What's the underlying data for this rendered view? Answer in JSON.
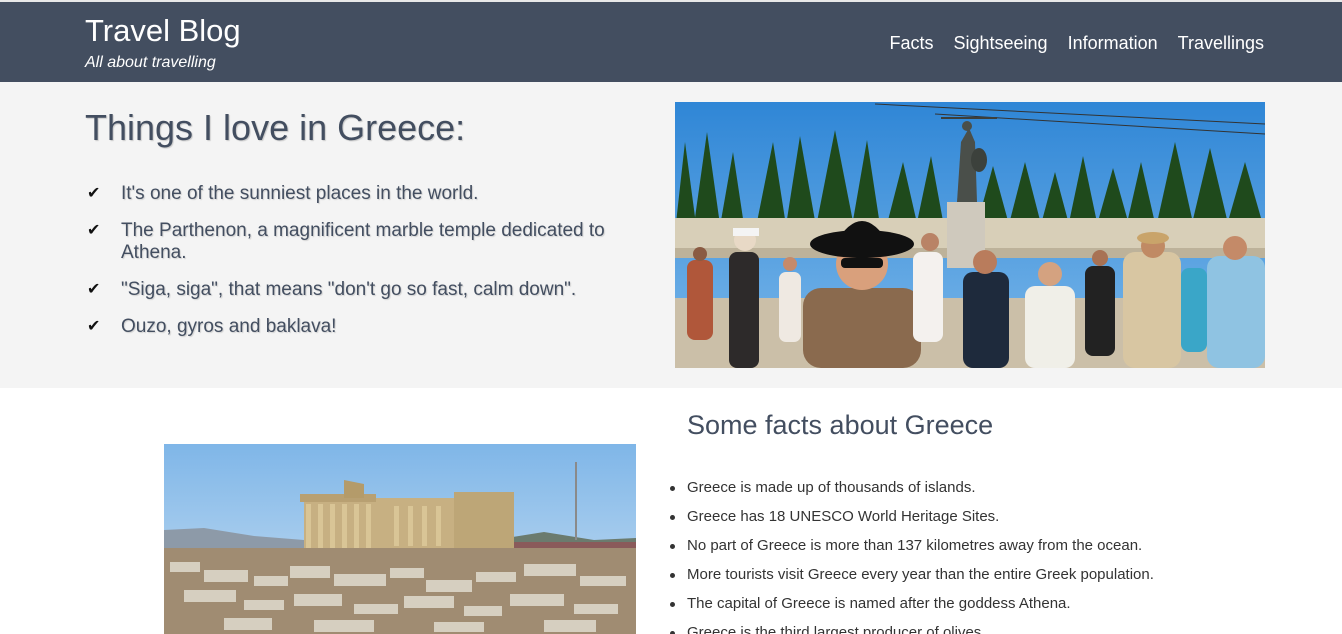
{
  "header": {
    "title": "Travel Blog",
    "tagline": "All about travelling",
    "nav": [
      "Facts",
      "Sightseeing",
      "Information",
      "Travellings"
    ],
    "background": "#434e60"
  },
  "hero": {
    "title": "Things I love in Greece:",
    "items": [
      "It's one of the sunniest places in the world.",
      "The Parthenon, a magnificent marble temple dedicated to Athena.",
      "\"Siga, siga\", that means \"don't go so fast, calm down\".",
      "Ouzo, gyros and baklava!"
    ],
    "check_icon": "checkmark-icon",
    "background": "#f4f4f4"
  },
  "facts": {
    "title": "Some facts about Greece",
    "items": [
      "Greece is made up of thousands of islands.",
      "Greece has 18 UNESCO World Heritage Sites.",
      "No part of Greece is more than 137 kilometres away from the ocean.",
      "More tourists visit Greece every year than the entire Greek population.",
      "The capital of Greece is named after the goddess Athena.",
      "Greece is the third largest producer of olives."
    ]
  }
}
